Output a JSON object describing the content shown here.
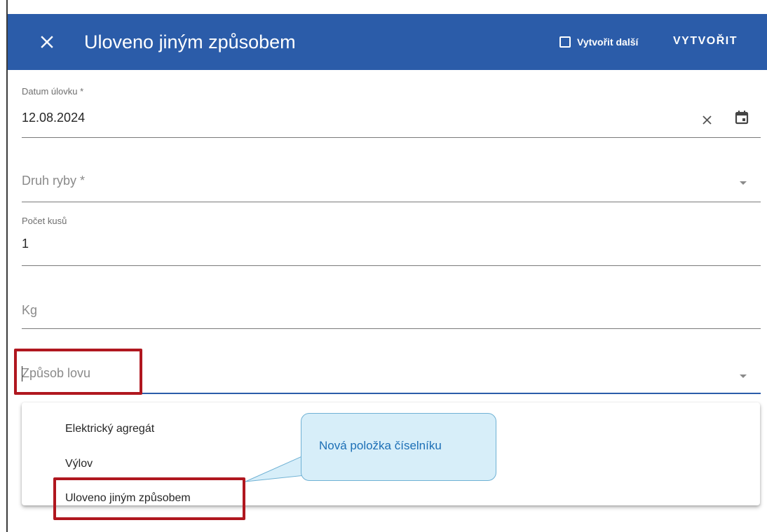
{
  "dialog": {
    "title": "Uloveno jiným způsobem",
    "create_another_label": "Vytvořit další",
    "create_button_label": "VYTVOŘIT",
    "header_color": "#2b5ca9"
  },
  "fields": {
    "date": {
      "label": "Datum úlovku *",
      "value": "12.08.2024"
    },
    "fish_species": {
      "placeholder": "Druh ryby *"
    },
    "count": {
      "label": "Počet kusů",
      "value": "1"
    },
    "kg": {
      "placeholder": "Kg"
    },
    "fishing_method": {
      "placeholder": "Způsob lovu",
      "focused_underline_color": "#2b5ca9"
    }
  },
  "dropdown_menu": {
    "items": [
      {
        "label": "Elektrický agregát"
      },
      {
        "label": "Výlov"
      },
      {
        "label": "Uloveno jiným způsobem"
      }
    ]
  },
  "annotation": {
    "callout_text": "Nová položka číselníku",
    "highlight_color": "#b0171f"
  },
  "icons": {
    "close": "close-icon",
    "checkbox": "checkbox-icon",
    "clear": "clear-icon",
    "calendar": "calendar-icon",
    "dropdown": "chevron-down-icon"
  }
}
